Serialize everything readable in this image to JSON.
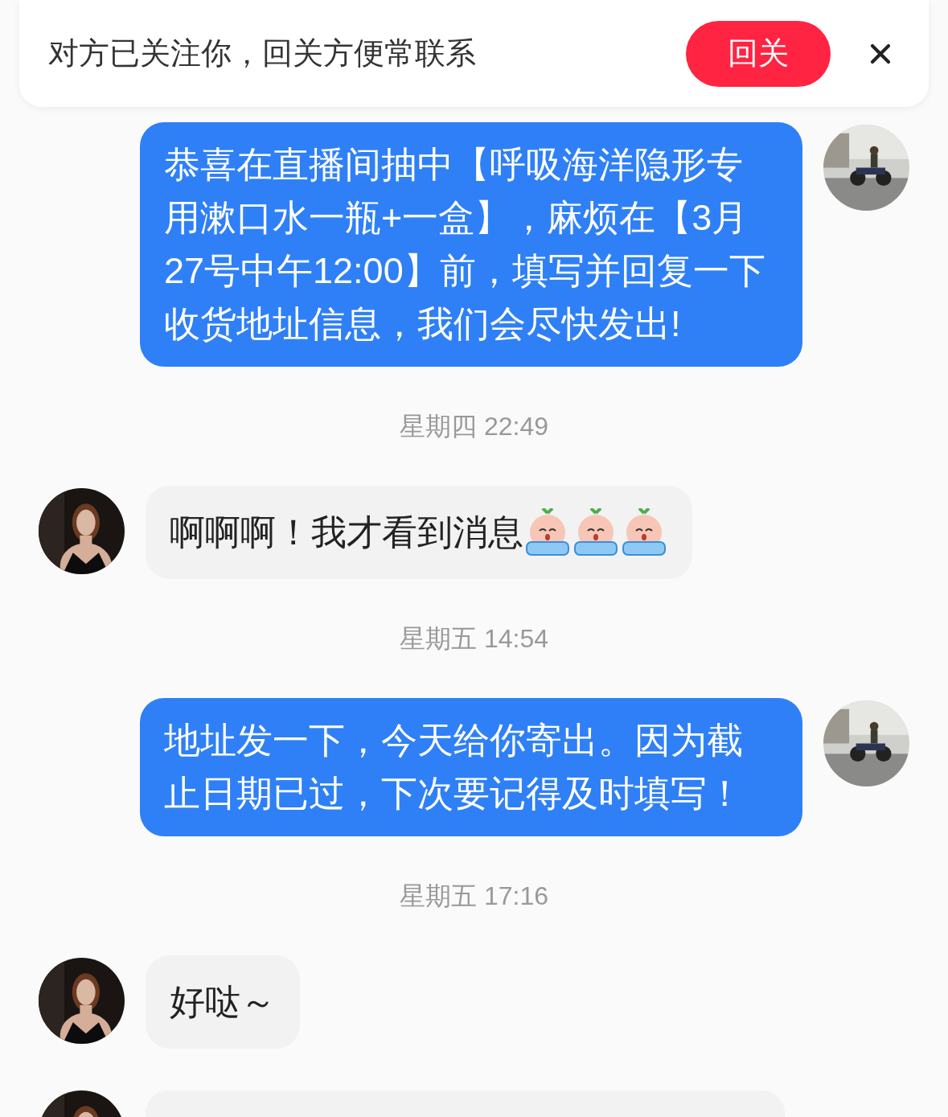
{
  "banner": {
    "text": "对方已关注你，回关方便常联系",
    "button": "回关"
  },
  "messages": [
    {
      "kind": "outgoing_bubble",
      "text": "恭喜在直播间抽中【呼吸海洋隐形专用漱口水一瓶+一盒】，麻烦在【3月27号中午12:00】前，填写并回复一下收货地址信息，我们会尽快发出!"
    },
    {
      "kind": "time",
      "text": "星期四 22:49"
    },
    {
      "kind": "incoming_bubble",
      "text": "啊啊啊！我才看到消息",
      "stickers": [
        {
          "kind": "crying"
        },
        {
          "kind": "crying"
        },
        {
          "kind": "crying"
        }
      ]
    },
    {
      "kind": "time",
      "text": "星期五 14:54"
    },
    {
      "kind": "outgoing_bubble",
      "text": "地址发一下，今天给你寄出。因为截止日期已过，下次要记得及时填写！"
    },
    {
      "kind": "time",
      "text": "星期五 17:16"
    },
    {
      "kind": "incoming_bubble",
      "text": "好哒～"
    },
    {
      "kind": "incoming_cut_off"
    }
  ]
}
